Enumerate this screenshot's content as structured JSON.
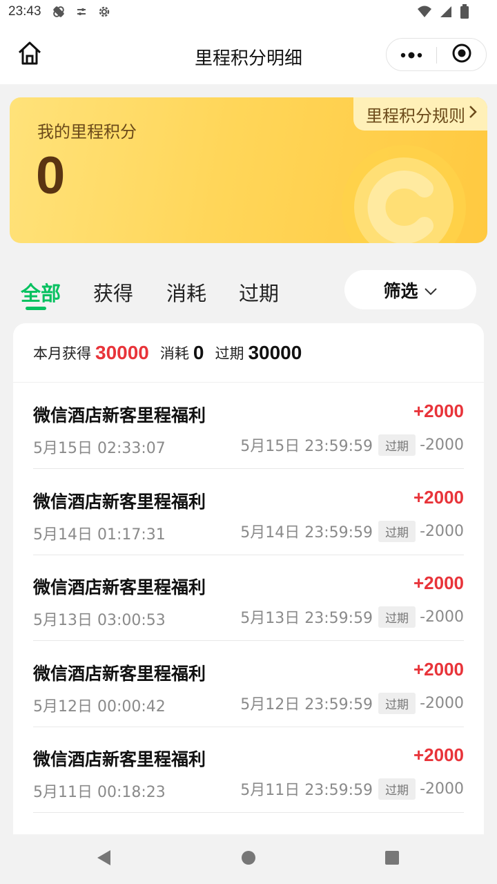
{
  "status_bar": {
    "time": "23:43"
  },
  "title_bar": {
    "title": "里程积分明细"
  },
  "points_card": {
    "label": "我的里程积分",
    "value": "0",
    "rules_link": "里程积分规则"
  },
  "tabs": [
    {
      "label": "全部",
      "active": true
    },
    {
      "label": "获得",
      "active": false
    },
    {
      "label": "消耗",
      "active": false
    },
    {
      "label": "过期",
      "active": false
    }
  ],
  "filter": {
    "label": "筛选"
  },
  "summary": {
    "earned_label": "本月获得",
    "earned_value": "30000",
    "consumed_label": "消耗",
    "consumed_value": "0",
    "expired_label": "过期",
    "expired_value": "30000"
  },
  "records": [
    {
      "title": "微信酒店新客里程福利",
      "amount": "+2000",
      "time": "5月15日 02:33:07",
      "expire_time": "5月15日 23:59:59",
      "expire_tag": "过期",
      "expire_amount": "-2000"
    },
    {
      "title": "微信酒店新客里程福利",
      "amount": "+2000",
      "time": "5月14日 01:17:31",
      "expire_time": "5月14日 23:59:59",
      "expire_tag": "过期",
      "expire_amount": "-2000"
    },
    {
      "title": "微信酒店新客里程福利",
      "amount": "+2000",
      "time": "5月13日 03:00:53",
      "expire_time": "5月13日 23:59:59",
      "expire_tag": "过期",
      "expire_amount": "-2000"
    },
    {
      "title": "微信酒店新客里程福利",
      "amount": "+2000",
      "time": "5月12日 00:00:42",
      "expire_time": "5月12日 23:59:59",
      "expire_tag": "过期",
      "expire_amount": "-2000"
    },
    {
      "title": "微信酒店新客里程福利",
      "amount": "+2000",
      "time": "5月11日 00:18:23",
      "expire_time": "5月11日 23:59:59",
      "expire_tag": "过期",
      "expire_amount": "-2000"
    }
  ],
  "colors": {
    "accent_green": "#07c160",
    "amount_red": "#e8343a",
    "card_gold": "#ffd659",
    "card_text_brown": "#5a3412"
  },
  "icons": {
    "status": [
      "bandage-icon",
      "sliders-icon",
      "gear-icon",
      "wifi-icon",
      "signal-icon",
      "battery-icon"
    ],
    "title_bar": [
      "home-icon",
      "more-dots-icon",
      "target-icon"
    ],
    "navigation": [
      "back-triangle-icon",
      "home-circle-icon",
      "recents-square-icon"
    ]
  }
}
